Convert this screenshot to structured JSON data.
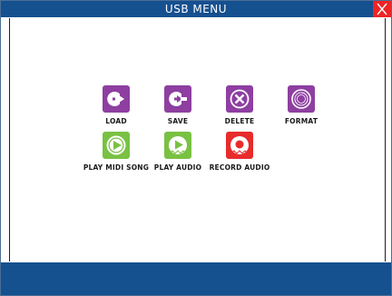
{
  "window": {
    "title": "USB MENU"
  },
  "menu": {
    "items": [
      {
        "label": "LOAD",
        "icon": "load-icon",
        "color": "#8e3fa1"
      },
      {
        "label": "SAVE",
        "icon": "save-icon",
        "color": "#8e3fa1"
      },
      {
        "label": "DELETE",
        "icon": "delete-icon",
        "color": "#8e3fa1"
      },
      {
        "label": "FORMAT",
        "icon": "format-icon",
        "color": "#8e3fa1"
      },
      {
        "label": "PLAY MIDI SONG",
        "icon": "play-midi-song-icon",
        "color": "#79c143"
      },
      {
        "label": "PLAY AUDIO",
        "icon": "play-audio-icon",
        "color": "#79c143"
      },
      {
        "label": "RECORD AUDIO",
        "icon": "record-audio-icon",
        "color": "#e82b2b"
      }
    ]
  },
  "colors": {
    "titlebar": "#15508f",
    "close_button": "#ef2323"
  }
}
